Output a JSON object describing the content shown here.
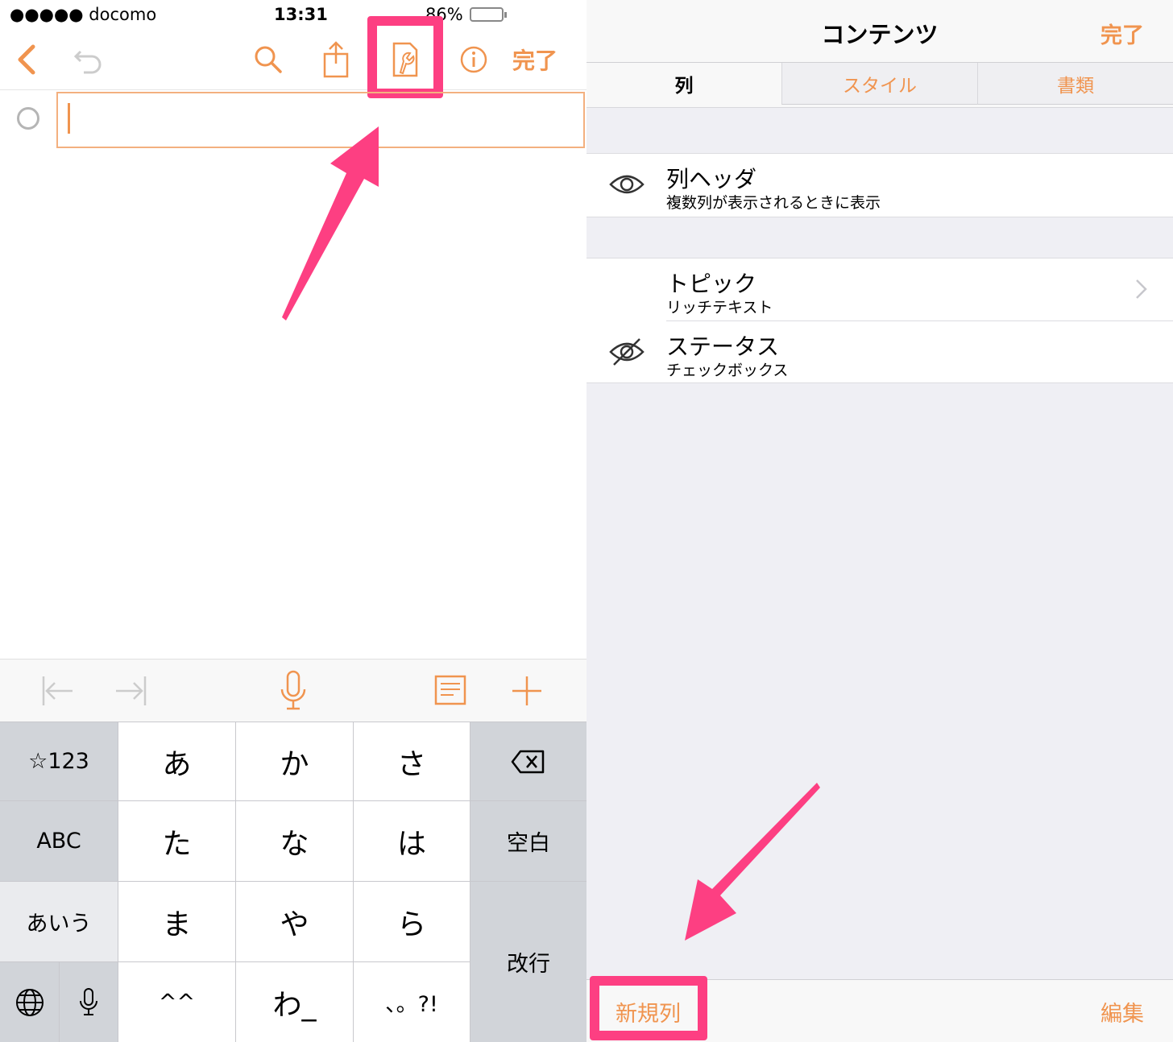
{
  "colors": {
    "accent": "#f0944f",
    "highlight": "#fd3f82",
    "battery": "#4cd964"
  },
  "status_bar": {
    "carrier": "●●●●● docomo",
    "time": "13:31",
    "battery": "86%",
    "battery_level": 0.86
  },
  "left_toolbar": {
    "back_icon": "chevron-left-icon",
    "undo_icon": "undo-icon",
    "search_icon": "search-icon",
    "share_icon": "share-icon",
    "inspector_icon": "document-wrench-icon",
    "info_icon": "info-icon",
    "done_label": "完了"
  },
  "editor": {
    "row_value": ""
  },
  "accessory_bar": {
    "outdent_icon": "outdent-icon",
    "indent_icon": "indent-icon",
    "dictation_icon": "microphone-icon",
    "note_icon": "note-icon",
    "add_icon": "plus-icon"
  },
  "keyboard": {
    "row1": [
      "☆123",
      "あ",
      "か",
      "さ"
    ],
    "delete_icon": "backspace-icon",
    "row2": [
      "ABC",
      "た",
      "な",
      "は",
      "空白"
    ],
    "row3": [
      "あいう",
      "ま",
      "や",
      "ら"
    ],
    "return": "改行",
    "globe_icon": "globe-icon",
    "mic_icon": "microphone-icon",
    "row4": [
      "^^",
      "わ_",
      "、。?!"
    ]
  },
  "right_nav": {
    "title": "コンテンツ",
    "done_label": "完了"
  },
  "segments": [
    "列",
    "スタイル",
    "書類"
  ],
  "header_cell": {
    "title": "列ヘッダ",
    "subtitle": "複数列が表示されるときに表示",
    "icon": "eye-icon"
  },
  "columns": [
    {
      "title": "トピック",
      "subtitle": "リッチテキスト",
      "accessory": "chevron-right-icon"
    },
    {
      "title": "ステータス",
      "subtitle": "チェックボックス",
      "icon": "eye-slash-icon"
    }
  ],
  "bottom_bar": {
    "new_column": "新規列",
    "edit": "編集"
  }
}
